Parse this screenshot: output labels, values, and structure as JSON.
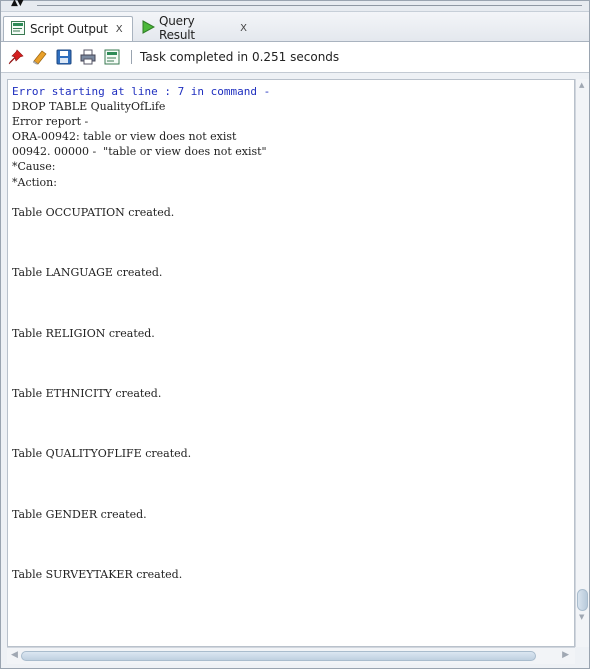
{
  "tabs": [
    {
      "label": "Script Output",
      "close": "X"
    },
    {
      "label": "Query Result",
      "close": "X"
    }
  ],
  "toolbar": {
    "status": "Task completed in 0.251 seconds",
    "icons": [
      "pin-icon",
      "eraser-icon",
      "save-icon",
      "print-icon",
      "script-output-icon"
    ]
  },
  "output": {
    "error_lines": [
      "Error starting at line : 7 in command -"
    ],
    "lines": [
      "DROP TABLE QualityOfLife",
      "Error report -",
      "ORA-00942: table or view does not exist",
      "00942. 00000 -  \"table or view does not exist\"",
      "*Cause:",
      "*Action:",
      "",
      "Table OCCUPATION created.",
      "",
      "",
      "",
      "Table LANGUAGE created.",
      "",
      "",
      "",
      "Table RELIGION created.",
      "",
      "",
      "",
      "Table ETHNICITY created.",
      "",
      "",
      "",
      "Table QUALITYOFLIFE created.",
      "",
      "",
      "",
      "Table GENDER created.",
      "",
      "",
      "",
      "Table SURVEYTAKER created."
    ]
  },
  "colors": {
    "error_text": "#1f2fbf",
    "pin": "#d42020",
    "eraser": "#e8a02a",
    "save": "#2f6fbf",
    "script_icon": "#2e8b57"
  }
}
